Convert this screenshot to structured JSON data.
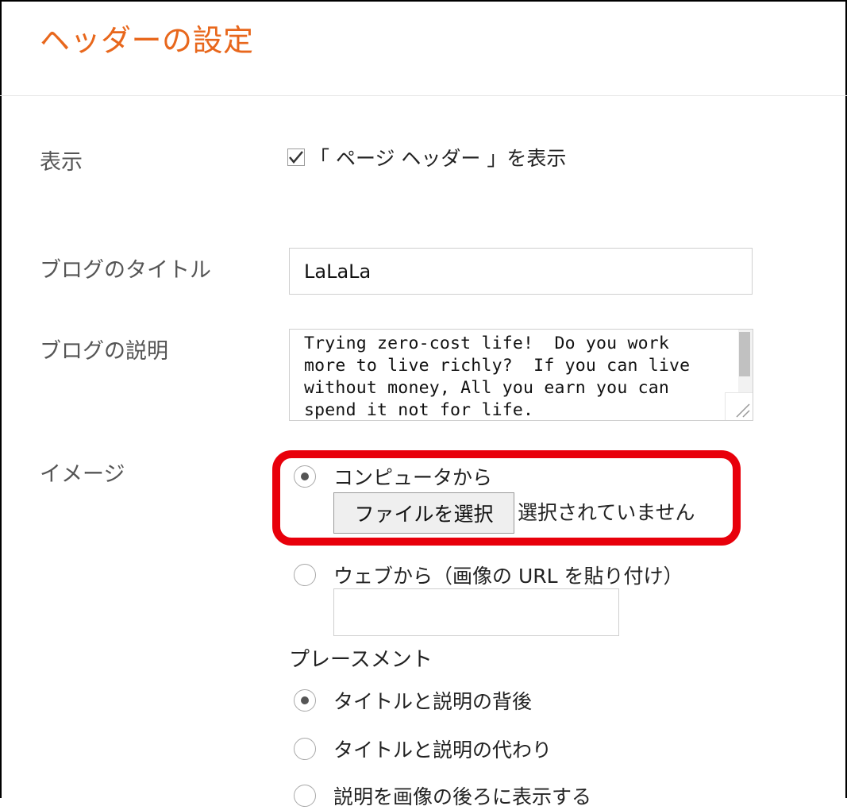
{
  "header": {
    "title": "ヘッダーの設定"
  },
  "display": {
    "label": "表示",
    "checkbox_label": "「 ページ ヘッダー 」を表示",
    "checked": true
  },
  "blog_title": {
    "label": "ブログのタイトル",
    "value": "LaLaLa"
  },
  "blog_description": {
    "label": "ブログの説明",
    "value": "Trying zero-cost life!  Do you work\nmore to live richly?  If you can live\nwithout money, All you earn you can\nspend it not for life."
  },
  "image": {
    "label": "イメージ",
    "source_options": [
      {
        "label": "コンピュータから",
        "selected": true
      },
      {
        "label": "ウェブから（画像の URL を貼り付け）",
        "selected": false
      }
    ],
    "file_button_label": "ファイルを選択",
    "file_status": "選択されていません",
    "url_value": ""
  },
  "placement": {
    "label": "プレースメント",
    "options": [
      {
        "label": "タイトルと説明の背後",
        "selected": true
      },
      {
        "label": "タイトルと説明の代わり",
        "selected": false
      },
      {
        "label": "説明を画像の後ろに表示する",
        "selected": false
      }
    ]
  },
  "colors": {
    "title": "#e8671c",
    "highlight": "#e8000b"
  }
}
